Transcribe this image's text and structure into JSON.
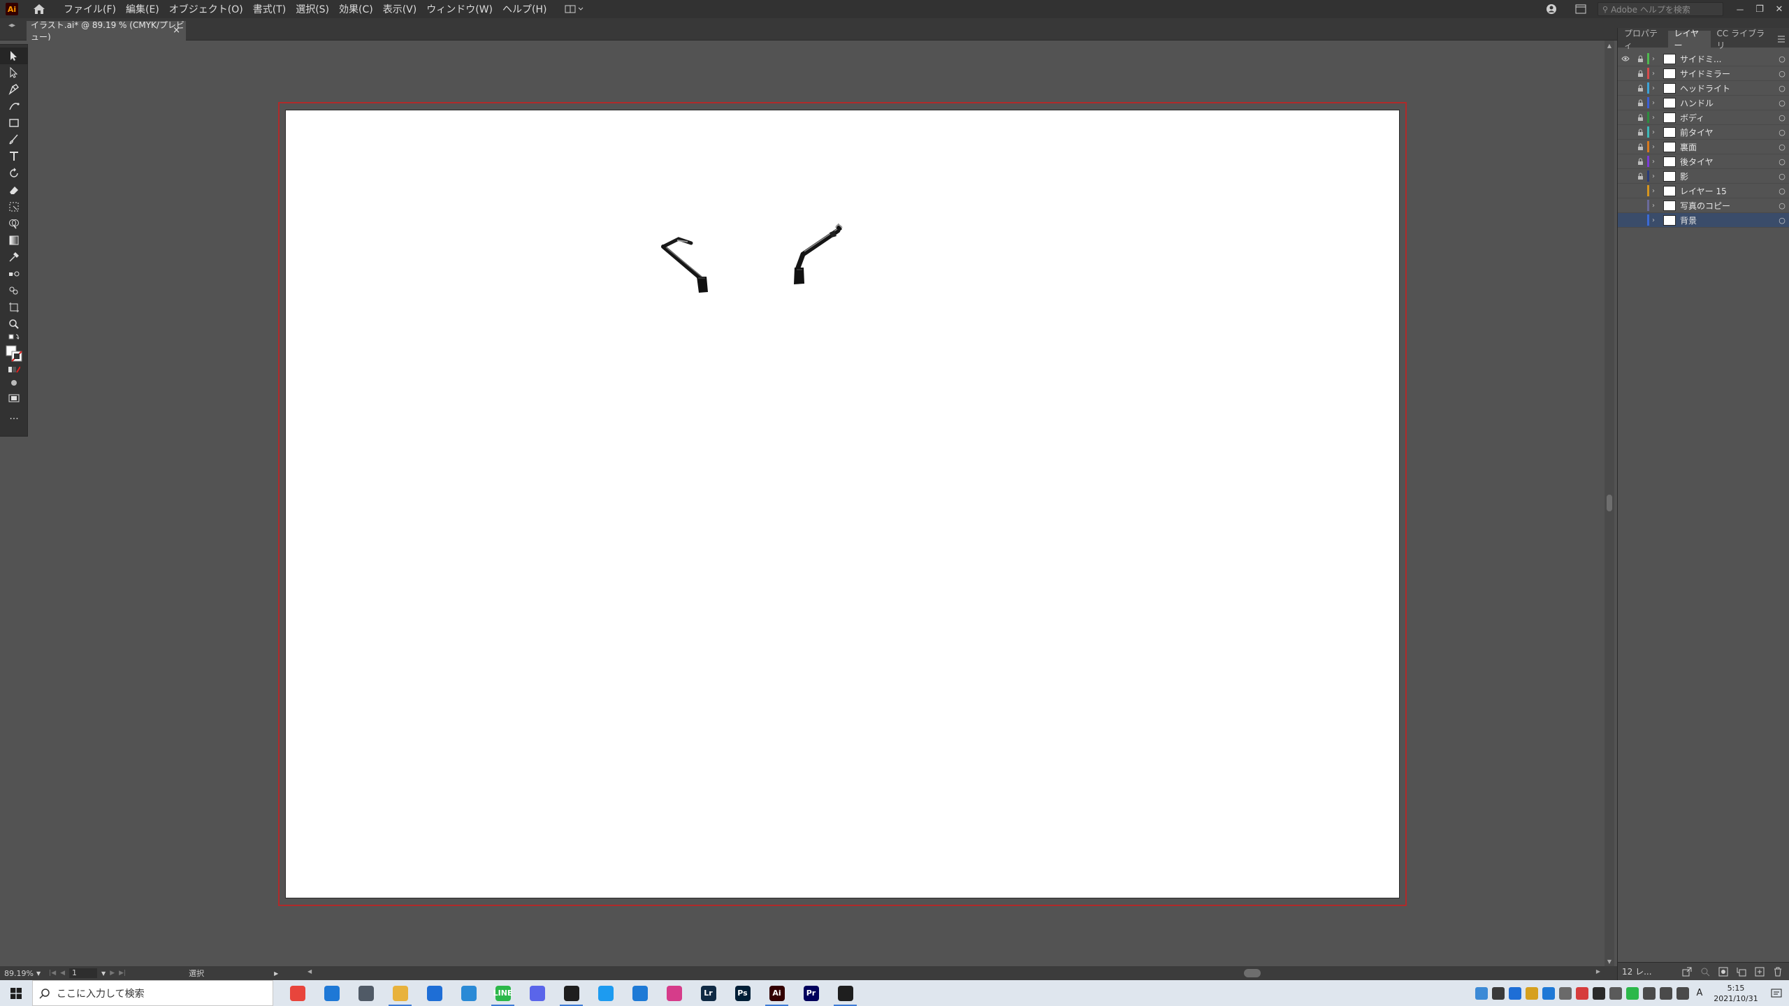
{
  "app": {
    "logo": "Ai",
    "menus": [
      "ファイル(F)",
      "編集(E)",
      "オブジェクト(O)",
      "書式(T)",
      "選択(S)",
      "効果(C)",
      "表示(V)",
      "ウィンドウ(W)",
      "ヘルプ(H)"
    ],
    "search_placeholder": "Adobe ヘルプを検索",
    "window_controls": [
      "－",
      "❐",
      "✕"
    ]
  },
  "document": {
    "tab_title": "イラスト.ai* @ 89.19 % (CMYK/プレビュー)",
    "tab_close": "×"
  },
  "tools": [
    "selection-tool",
    "direct-selection-tool",
    "pen-tool",
    "curvature-tool",
    "rectangle-tool",
    "paintbrush-tool",
    "type-tool",
    "rotate-tool",
    "eraser-tool",
    "free-transform-tool",
    "shape-builder-tool",
    "gradient-tool",
    "eyedropper-tool",
    "blend-tool",
    "symbol-sprayer-tool",
    "artboard-tool",
    "zoom-tool"
  ],
  "panel": {
    "tabs": [
      "プロパティ",
      "レイヤー",
      "CC ライブラリ"
    ],
    "active_tab": "レイヤー",
    "layers": [
      {
        "name": "サイドミ...",
        "color": "#4fb84f",
        "visible": true,
        "locked": true
      },
      {
        "name": "サイドミラー",
        "color": "#d64b4b",
        "visible": false,
        "locked": true
      },
      {
        "name": "ヘッドライト",
        "color": "#3ca3d6",
        "visible": false,
        "locked": true
      },
      {
        "name": "ハンドル",
        "color": "#3c5fd6",
        "visible": false,
        "locked": true
      },
      {
        "name": "ボディ",
        "color": "#2e8b3e",
        "visible": false,
        "locked": true
      },
      {
        "name": "前タイヤ",
        "color": "#3cb8b8",
        "visible": false,
        "locked": true
      },
      {
        "name": "裏面",
        "color": "#d67a1e",
        "visible": false,
        "locked": true
      },
      {
        "name": "後タイヤ",
        "color": "#7a3cd6",
        "visible": false,
        "locked": true
      },
      {
        "name": "影",
        "color": "#2a3c7a",
        "visible": false,
        "locked": true
      },
      {
        "name": "レイヤー 15",
        "color": "#d6951e",
        "visible": false,
        "locked": false
      },
      {
        "name": "写真のコピー",
        "color": "#6a6a9a",
        "visible": false,
        "locked": false
      },
      {
        "name": "背景",
        "color": "#3c6ad6",
        "visible": false,
        "locked": false,
        "selected": true
      }
    ],
    "footer_count": "12 レ..."
  },
  "status": {
    "zoom": "89.19%",
    "artboard_number": "1",
    "tool_name": "選択"
  },
  "taskbar": {
    "search_placeholder": "ここに入力して検索",
    "apps": [
      {
        "name": "chrome-app",
        "color": "#e8453c",
        "label": ""
      },
      {
        "name": "mail-app",
        "color": "#1e78d6",
        "label": ""
      },
      {
        "name": "calculator-app",
        "color": "#505a66",
        "label": ""
      },
      {
        "name": "file-explorer-app",
        "color": "#e8b23c",
        "label": ""
      },
      {
        "name": "dropbox-app",
        "color": "#1e6ed6",
        "label": ""
      },
      {
        "name": "photos-app",
        "color": "#2a8ad6",
        "label": ""
      },
      {
        "name": "line-app",
        "color": "#2cb84a",
        "label": "LINE"
      },
      {
        "name": "discord-app",
        "color": "#5a65ea",
        "label": ""
      },
      {
        "name": "terminal-app",
        "color": "#1e1e1e",
        "label": ""
      },
      {
        "name": "twitter-app",
        "color": "#1d9bf0",
        "label": ""
      },
      {
        "name": "vscode-app",
        "color": "#1e7ad6",
        "label": ""
      },
      {
        "name": "instagram-app",
        "color": "#d63c8a",
        "label": ""
      },
      {
        "name": "lightroom-app",
        "color": "#0f2a44",
        "label": "Lr"
      },
      {
        "name": "photoshop-app",
        "color": "#001e36",
        "label": "Ps"
      },
      {
        "name": "illustrator-app",
        "color": "#330000",
        "label": "Ai"
      },
      {
        "name": "premiere-app",
        "color": "#00005b",
        "label": "Pr"
      },
      {
        "name": "nvidia-app",
        "color": "#1e1e1e",
        "label": ""
      }
    ],
    "clock_time": "5:15",
    "clock_date": "2021/10/31",
    "ime": "A"
  }
}
